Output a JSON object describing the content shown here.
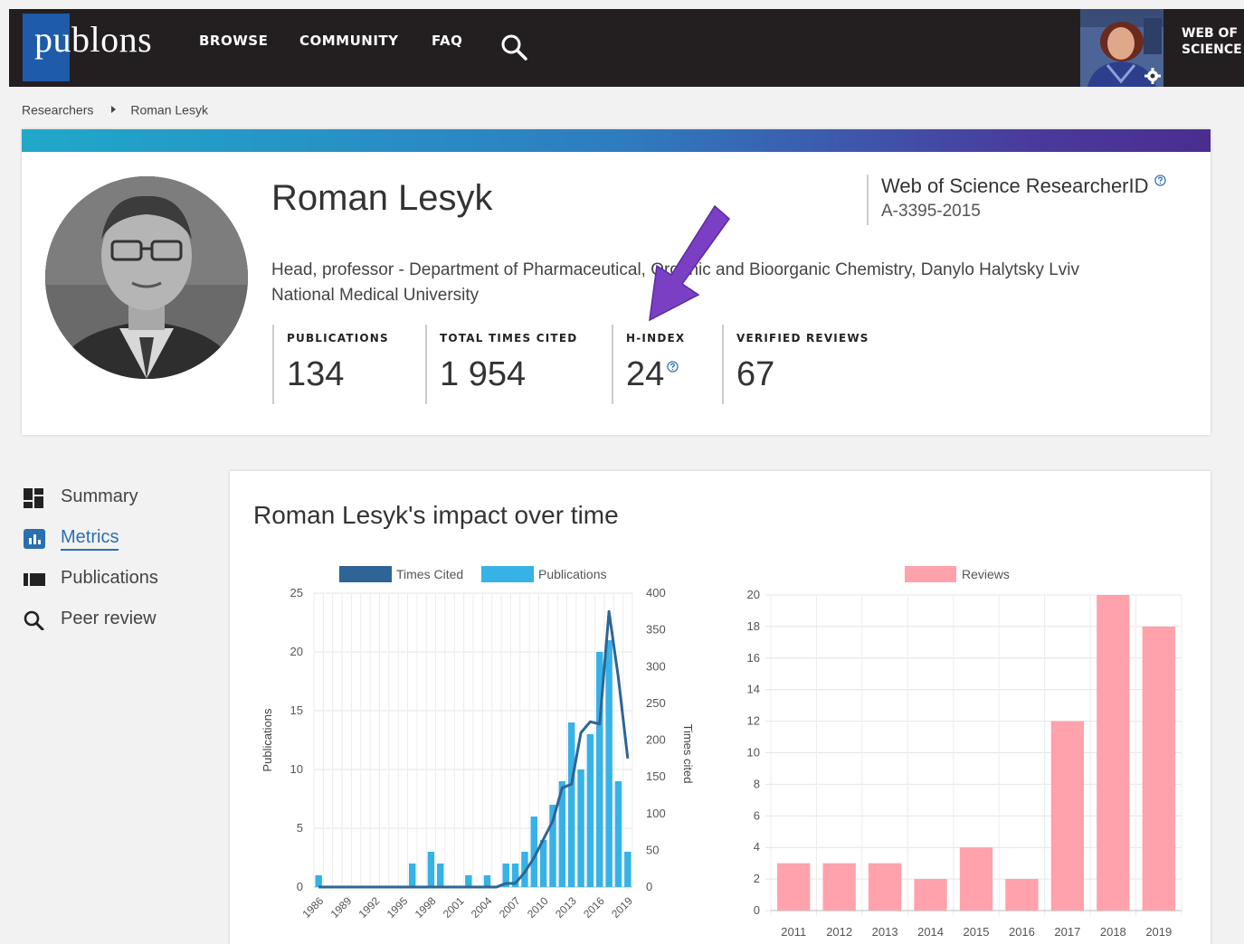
{
  "topbar": {
    "logo_text": "publons",
    "nav": [
      "BROWSE",
      "COMMUNITY",
      "FAQ"
    ],
    "wos_line1": "WEB OF",
    "wos_line2": "SCIENCE"
  },
  "breadcrumbs": [
    "Researchers",
    "Roman Lesyk"
  ],
  "profile": {
    "name": "Roman Lesyk",
    "affiliation": "Head, professor - Department of Pharmaceutical, Organic and Bioorganic Chemistry, Danylo Halytsky Lviv National Medical University",
    "researcher_id_label": "Web of Science ResearcherID",
    "researcher_id": "A-3395-2015",
    "metrics": [
      {
        "label": "PUBLICATIONS",
        "value": "134"
      },
      {
        "label": "TOTAL TIMES CITED",
        "value": "1 954"
      },
      {
        "label": "H-INDEX",
        "value": "24"
      },
      {
        "label": "VERIFIED REVIEWS",
        "value": "67"
      }
    ]
  },
  "sidenav": [
    {
      "label": "Summary",
      "icon": "dashboard-icon"
    },
    {
      "label": "Metrics",
      "icon": "bar-chart-icon",
      "active": true
    },
    {
      "label": "Publications",
      "icon": "book-icon"
    },
    {
      "label": "Peer review",
      "icon": "search-icon"
    }
  ],
  "impact_title": "Roman Lesyk's impact over time",
  "colors": {
    "times_cited": "#2e6496",
    "publications": "#36b2e6",
    "reviews": "#ffa2ab",
    "arrow": "#7b3fc4"
  },
  "chart_data": [
    {
      "type": "bar",
      "legend": [
        "Times Cited",
        "Publications"
      ],
      "years": [
        1986,
        1987,
        1988,
        1989,
        1990,
        1991,
        1992,
        1993,
        1994,
        1995,
        1996,
        1997,
        1998,
        1999,
        2000,
        2001,
        2002,
        2003,
        2004,
        2005,
        2006,
        2007,
        2008,
        2009,
        2010,
        2011,
        2012,
        2013,
        2014,
        2015,
        2016,
        2017,
        2018,
        2019
      ],
      "x_tick_labels": [
        "1986",
        "1989",
        "1992",
        "1995",
        "1998",
        "2001",
        "2004",
        "2007",
        "2010",
        "2013",
        "2016",
        "2019"
      ],
      "series": [
        {
          "name": "Publications",
          "axis": "left",
          "values": [
            1,
            0,
            0,
            0,
            0,
            0,
            0,
            0,
            0,
            0,
            2,
            0,
            3,
            2,
            0,
            0,
            1,
            0,
            1,
            0,
            2,
            2,
            3,
            6,
            4,
            7,
            9,
            14,
            10,
            13,
            20,
            21,
            9,
            3
          ]
        },
        {
          "name": "Times Cited",
          "axis": "right",
          "kind": "line",
          "values": [
            0,
            0,
            0,
            0,
            0,
            0,
            0,
            0,
            0,
            0,
            0,
            0,
            0,
            0,
            0,
            0,
            0,
            0,
            0,
            0,
            5,
            5,
            20,
            40,
            65,
            90,
            135,
            140,
            210,
            225,
            222,
            375,
            285,
            175
          ]
        }
      ],
      "ylabel_left": "Publications",
      "ylabel_right": "Times cited",
      "ylim_left": [
        0,
        25
      ],
      "yticks_left": [
        "0",
        "5",
        "10",
        "15",
        "20",
        "25"
      ],
      "ylim_right": [
        0,
        400
      ],
      "yticks_right": [
        "0",
        "50",
        "100",
        "150",
        "200",
        "250",
        "300",
        "350",
        "400"
      ]
    },
    {
      "type": "bar",
      "legend": [
        "Reviews"
      ],
      "categories": [
        "2011",
        "2012",
        "2013",
        "2014",
        "2015",
        "2016",
        "2017",
        "2018",
        "2019"
      ],
      "series": [
        {
          "name": "Reviews",
          "values": [
            3,
            3,
            3,
            2,
            4,
            2,
            12,
            20,
            18
          ]
        }
      ],
      "ylim": [
        0,
        20
      ],
      "yticks": [
        "0",
        "2",
        "4",
        "6",
        "8",
        "10",
        "12",
        "14",
        "16",
        "18",
        "20"
      ]
    }
  ]
}
